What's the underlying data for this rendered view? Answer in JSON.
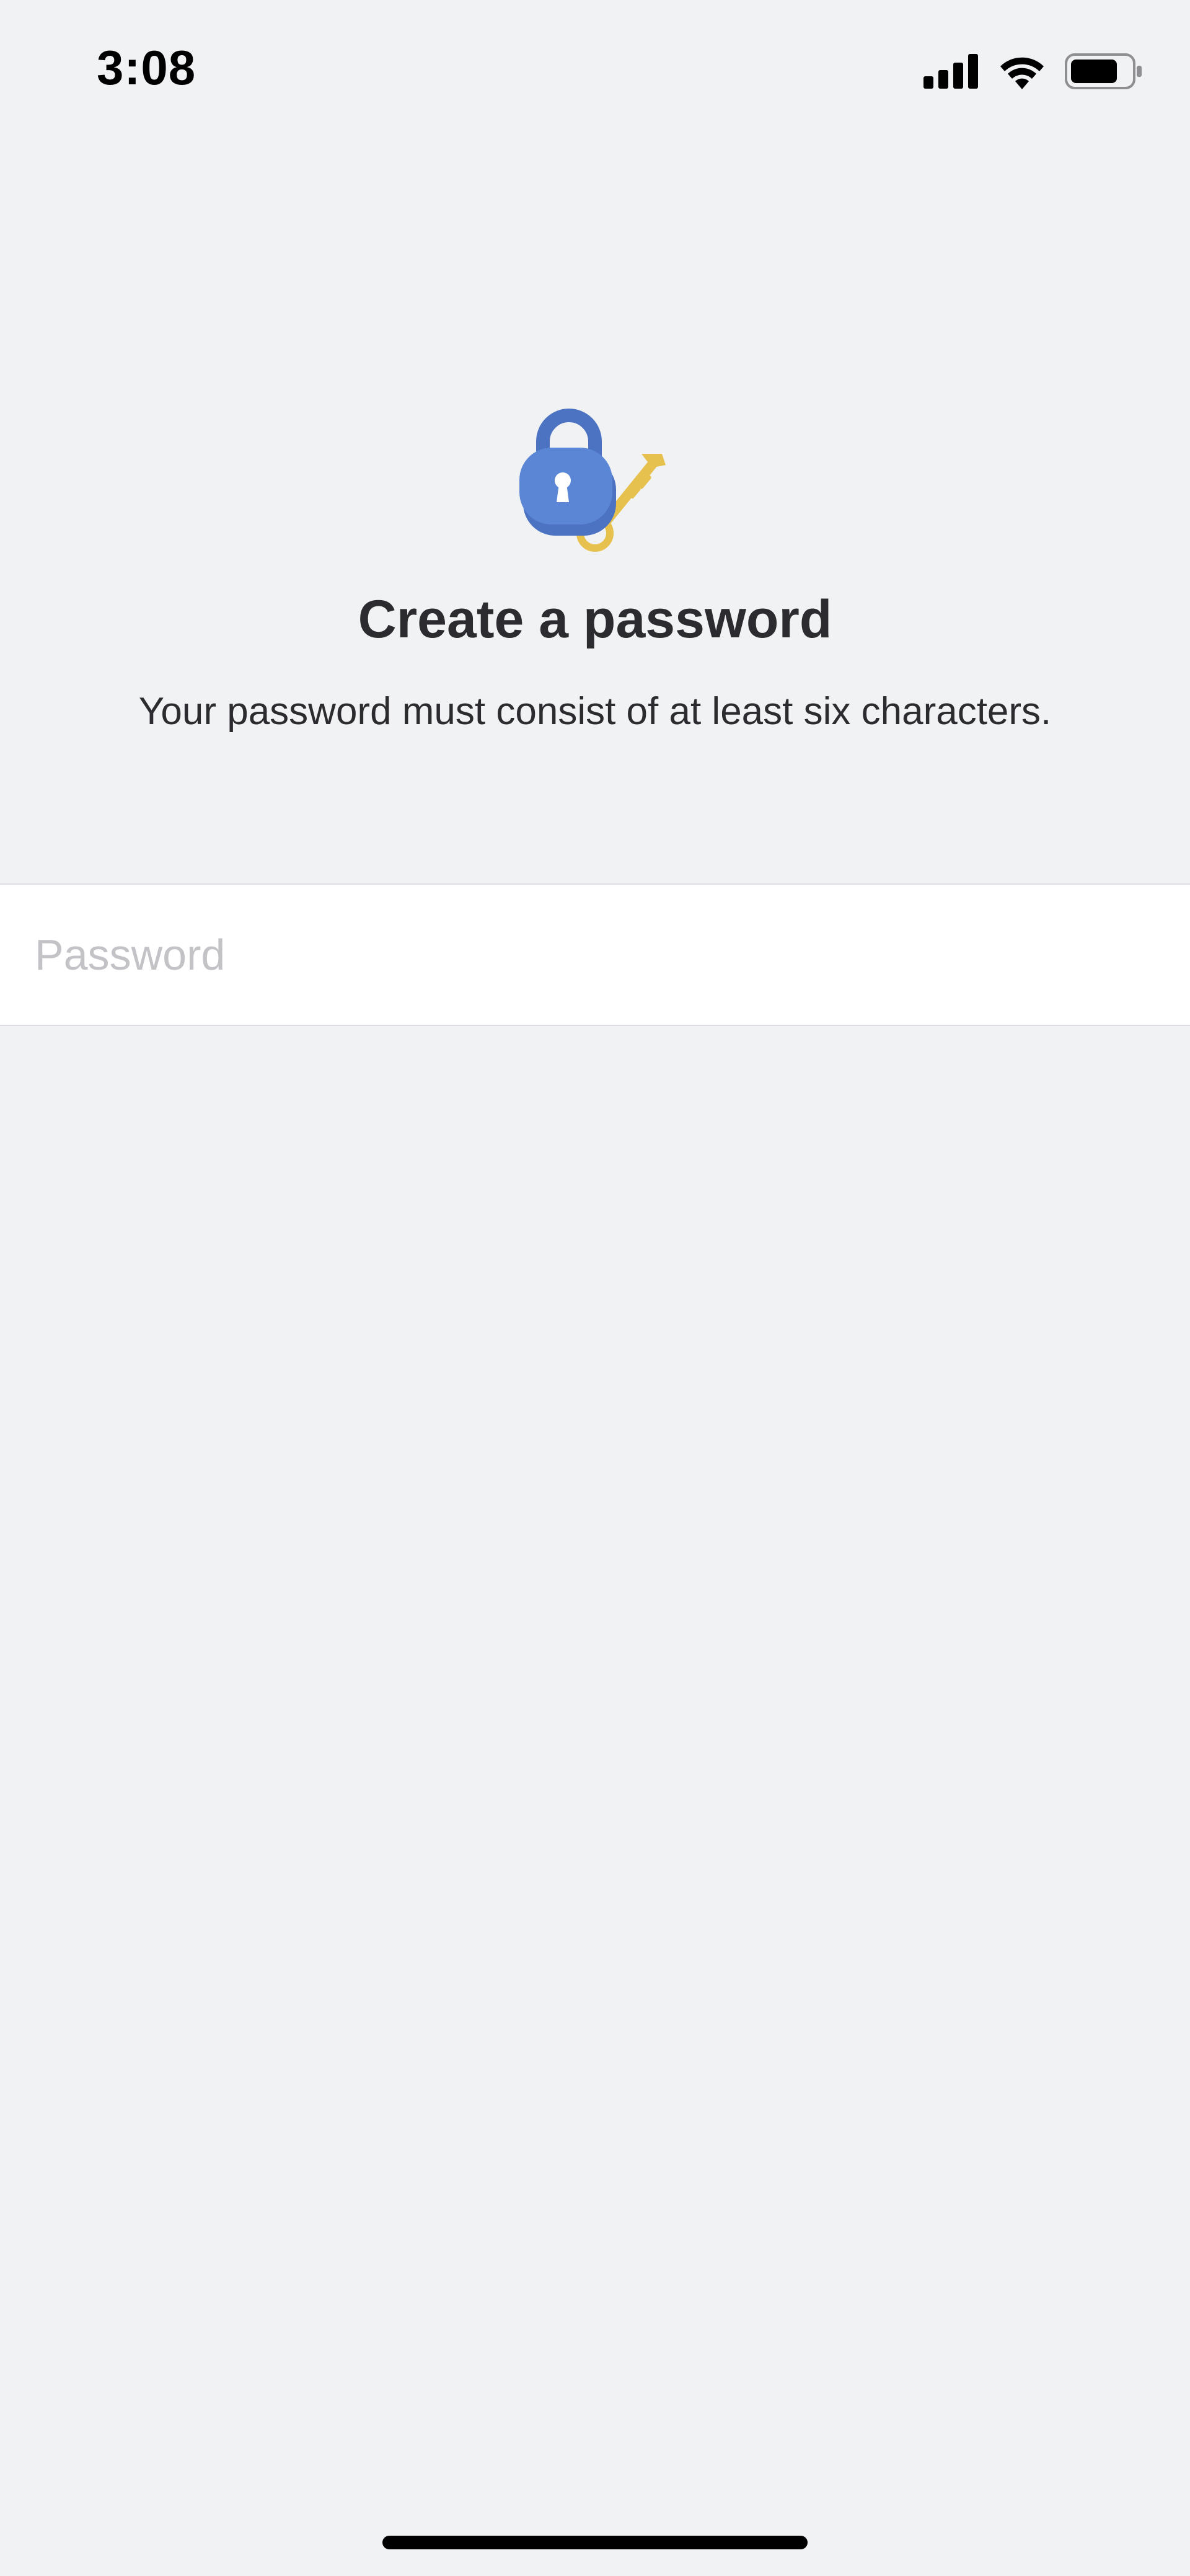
{
  "status_bar": {
    "time": "3:08",
    "icons": [
      "cellular-signal-icon",
      "wifi-icon",
      "battery-icon"
    ]
  },
  "hero": {
    "icon": "lock-and-key-icon",
    "title": "Create a password",
    "subtitle": "Your password must consist of at least six characters."
  },
  "form": {
    "password_placeholder": "Password",
    "password_value": ""
  },
  "colors": {
    "background": "#f1f2f4",
    "field_background": "#ffffff",
    "text_primary": "#2c2c30",
    "placeholder": "#c3c3c7",
    "lock_blue": "#5b86d6",
    "key_gold": "#e8c34f"
  }
}
